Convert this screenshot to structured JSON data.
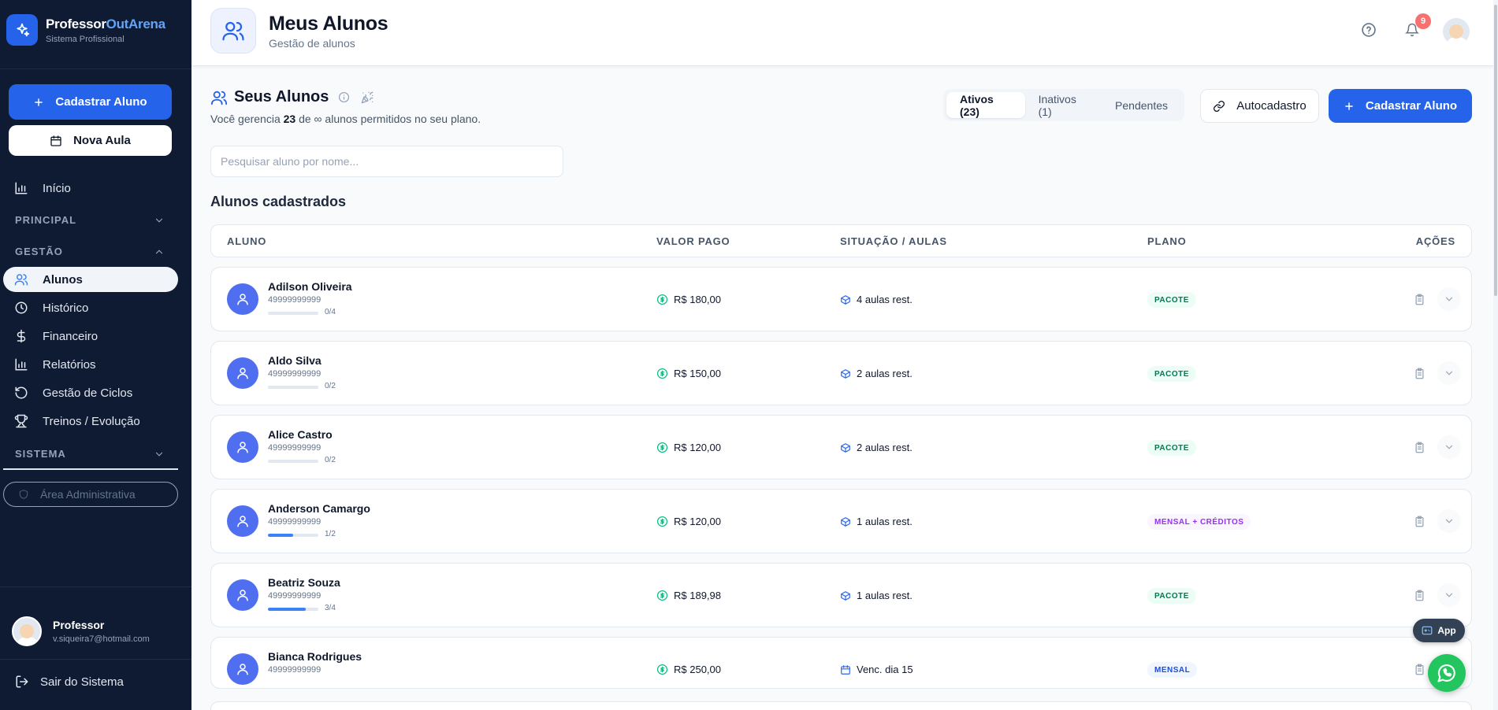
{
  "brand": {
    "name_part1": "Professor",
    "name_part2": "OutArena",
    "subtitle": "Sistema Profissional"
  },
  "sidebar": {
    "primary_button": "Cadastrar Aluno",
    "secondary_button": "Nova Aula",
    "home": "Início",
    "sections": {
      "principal": "PRINCIPAL",
      "gestao": "GESTÃO",
      "sistema": "SISTEMA"
    },
    "items": [
      {
        "label": "Alunos",
        "icon": "users-icon",
        "active": true
      },
      {
        "label": "Histórico",
        "icon": "clock-icon"
      },
      {
        "label": "Financeiro",
        "icon": "dollar-icon"
      },
      {
        "label": "Relatórios",
        "icon": "bar-chart-icon"
      },
      {
        "label": "Gestão de Ciclos",
        "icon": "rotate-icon"
      },
      {
        "label": "Treinos / Evolução",
        "icon": "trophy-icon"
      }
    ],
    "admin": "Área Administrativa",
    "user": {
      "name": "Professor",
      "email": "v.siqueira7@hotmail.com"
    },
    "logout": "Sair do Sistema"
  },
  "header": {
    "title": "Meus Alunos",
    "subtitle": "Gestão de alunos",
    "notifications": "9"
  },
  "main": {
    "title": "Seus Alunos",
    "desc_prefix": "Você gerencia ",
    "desc_count": "23",
    "desc_suffix": " de ∞ alunos permitidos no seu plano.",
    "tabs": {
      "ativos": "Ativos (23)",
      "inativos": "Inativos (1)",
      "pendentes": "Pendentes"
    },
    "autocadastro": "Autocadastro",
    "cadastrar": "Cadastrar Aluno",
    "search_placeholder": "Pesquisar aluno por nome...",
    "list_title": "Alunos cadastrados",
    "columns": {
      "aluno": "ALUNO",
      "valor": "VALOR PAGO",
      "situacao": "SITUAÇÃO / AULAS",
      "plano": "PLANO",
      "acoes": "AÇÕES"
    }
  },
  "students": [
    {
      "name": "Adilson Oliveira",
      "phone": "49999999999",
      "progress": "0/4",
      "progress_fraction": 0,
      "valor": "R$ 180,00",
      "situacao": "4 aulas rest.",
      "sit_icon": "box-icon",
      "plano": "PACOTE",
      "plan_color": "#047857"
    },
    {
      "name": "Aldo Silva",
      "phone": "49999999999",
      "progress": "0/2",
      "progress_fraction": 0,
      "valor": "R$ 150,00",
      "situacao": "2 aulas rest.",
      "sit_icon": "box-icon",
      "plano": "PACOTE",
      "plan_color": "#047857"
    },
    {
      "name": "Alice Castro",
      "phone": "49999999999",
      "progress": "0/2",
      "progress_fraction": 0,
      "valor": "R$ 120,00",
      "situacao": "2 aulas rest.",
      "sit_icon": "box-icon",
      "plano": "PACOTE",
      "plan_color": "#047857"
    },
    {
      "name": "Anderson Camargo",
      "phone": "49999999999",
      "progress": "1/2",
      "progress_fraction": 0.5,
      "valor": "R$ 120,00",
      "situacao": "1 aulas rest.",
      "sit_icon": "box-icon",
      "plano": "MENSAL + CRÉDITOS",
      "plan_color": "#9333ea"
    },
    {
      "name": "Beatriz Souza",
      "phone": "49999999999",
      "progress": "3/4",
      "progress_fraction": 0.75,
      "valor": "R$ 189,98",
      "situacao": "1 aulas rest.",
      "sit_icon": "box-icon",
      "plano": "PACOTE",
      "plan_color": "#047857"
    },
    {
      "name": "Bianca Rodrigues",
      "phone": "49999999999",
      "progress": "",
      "progress_fraction": null,
      "valor": "R$ 250,00",
      "situacao": "Venc. dia 15",
      "sit_icon": "calendar-icon",
      "plano": "MENSAL",
      "plan_color": "#1d4ed8"
    }
  ],
  "floating": {
    "app": "App"
  },
  "colors": {
    "sidebar_bg": "#0f1b33",
    "primary": "#2563eb",
    "success": "#22c55e",
    "badge": "#f87171"
  }
}
